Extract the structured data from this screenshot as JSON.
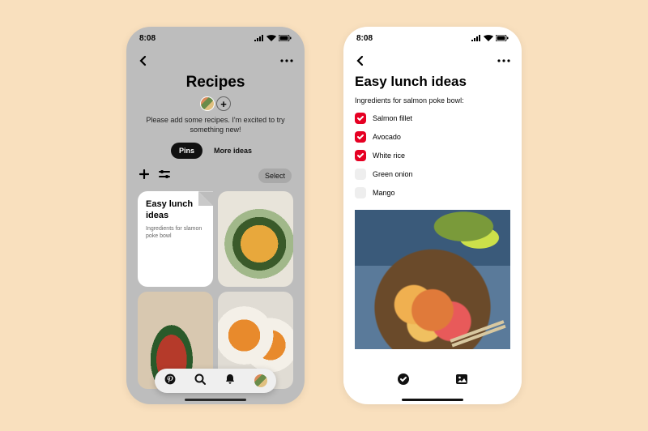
{
  "statusbar": {
    "time": "8:08"
  },
  "left": {
    "title": "Recipes",
    "description_l1": "Please add some recipes. I'm excited to try",
    "description_l2": "something new!",
    "tabs": {
      "pins": "Pins",
      "more": "More ideas"
    },
    "select": "Select",
    "note": {
      "title_l1": "Easy lunch",
      "title_l2": "ideas",
      "sub_l1": "Ingredients for slamon",
      "sub_l2": "poke bowl"
    }
  },
  "right": {
    "title": "Easy lunch ideas",
    "subtitle": "Ingredients for salmon poke bowl:",
    "items": [
      {
        "label": "Salmon fillet",
        "checked": true
      },
      {
        "label": "Avocado",
        "checked": true
      },
      {
        "label": "White rice",
        "checked": true
      },
      {
        "label": "Green onion",
        "checked": false
      },
      {
        "label": "Mango",
        "checked": false
      }
    ]
  }
}
